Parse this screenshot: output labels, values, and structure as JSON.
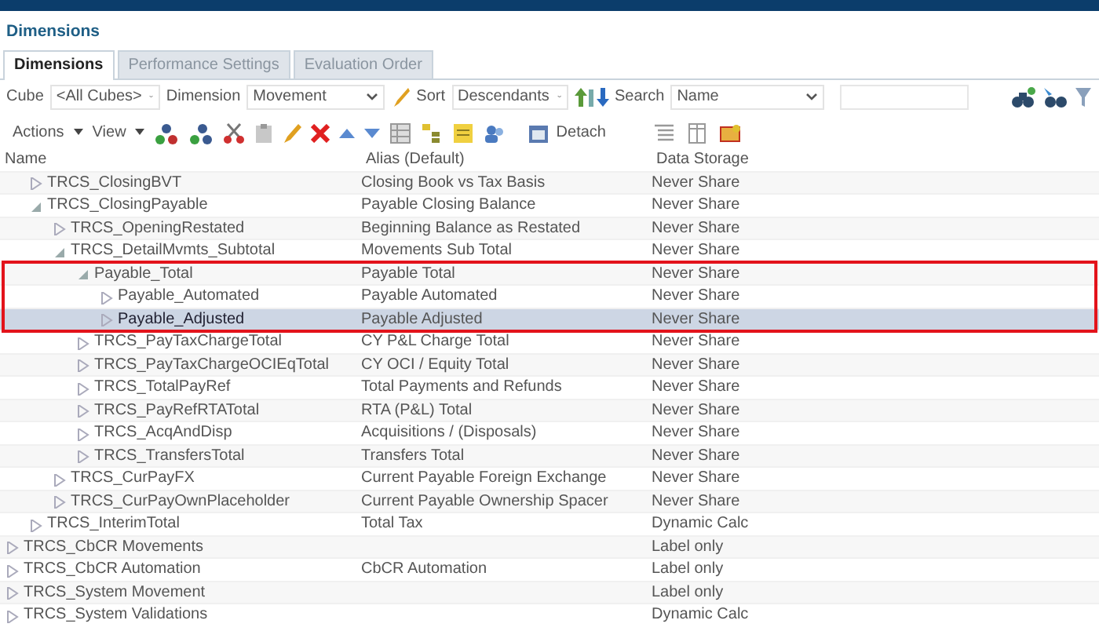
{
  "page_title": "Dimensions",
  "tabs": [
    {
      "label": "Dimensions",
      "selected": true
    },
    {
      "label": "Performance Settings",
      "selected": false
    },
    {
      "label": "Evaluation Order",
      "selected": false
    }
  ],
  "filters": {
    "cube_label": "Cube",
    "cube_value": "<All Cubes>",
    "dimension_label": "Dimension",
    "dimension_value": "Movement",
    "sort_label": "Sort",
    "sort_value": "Descendants",
    "search_label": "Search",
    "search_value": "Name"
  },
  "toolbar": {
    "actions": "Actions",
    "view": "View",
    "detach": "Detach"
  },
  "columns": [
    "Name",
    "Alias (Default)",
    "Data Storage"
  ],
  "tree": {
    "continued_items": [
      {
        "name": "TRCS_ClosingBVT",
        "alias": "Closing Book vs Tax Basis",
        "storage": "Never Share",
        "expanded": false,
        "selected": false
      },
      {
        "name": "TRCS_ClosingPayable",
        "alias": "Payable Closing Balance",
        "storage": "Never Share",
        "expanded": true,
        "selected": false,
        "children": [
          {
            "name": "TRCS_OpeningRestated",
            "alias": "Beginning Balance as Restated",
            "storage": "Never Share",
            "expanded": false,
            "selected": false
          },
          {
            "name": "TRCS_DetailMvmts_Subtotal",
            "alias": "Movements Sub Total",
            "storage": "Never Share",
            "expanded": true,
            "selected": false,
            "children": [
              {
                "name": "Payable_Total",
                "alias": "Payable Total",
                "storage": "Never Share",
                "expanded": true,
                "selected": false,
                "outlined": true,
                "children": [
                  {
                    "name": "Payable_Automated",
                    "alias": "Payable Automated",
                    "storage": "Never Share",
                    "expanded": false,
                    "selected": false,
                    "outlined": true
                  },
                  {
                    "name": "Payable_Adjusted",
                    "alias": "Payable Adjusted",
                    "storage": "Never Share",
                    "expanded": false,
                    "selected": true,
                    "outlined": true
                  }
                ]
              },
              {
                "name": "TRCS_PayTaxChargeTotal",
                "alias": "CY P&L Charge Total",
                "storage": "Never Share",
                "expanded": false,
                "selected": false
              },
              {
                "name": "TRCS_PayTaxChargeOCIEqTotal",
                "alias": "CY OCI / Equity Total",
                "storage": "Never Share",
                "expanded": false,
                "selected": false
              },
              {
                "name": "TRCS_TotalPayRef",
                "alias": "Total Payments and Refunds",
                "storage": "Never Share",
                "expanded": false,
                "selected": false
              },
              {
                "name": "TRCS_PayRefRTATotal",
                "alias": "RTA (P&L) Total",
                "storage": "Never Share",
                "expanded": false,
                "selected": false
              },
              {
                "name": "TRCS_AcqAndDisp",
                "alias": "Acquisitions / (Disposals)",
                "storage": "Never Share",
                "expanded": false,
                "selected": false
              },
              {
                "name": "TRCS_TransfersTotal",
                "alias": "Transfers Total",
                "storage": "Never Share",
                "expanded": false,
                "selected": false
              }
            ]
          },
          {
            "name": "TRCS_CurPayFX",
            "alias": "Current Payable Foreign Exchange",
            "storage": "Never Share",
            "expanded": false,
            "selected": false
          },
          {
            "name": "TRCS_CurPayOwnPlaceholder",
            "alias": "Current Payable Ownership Spacer",
            "storage": "Never Share",
            "expanded": false,
            "selected": false
          }
        ]
      },
      {
        "name": "TRCS_InterimTotal",
        "alias": "Total Tax",
        "storage": "Dynamic Calc",
        "expanded": false,
        "selected": false
      }
    ],
    "root_items": [
      {
        "name": "TRCS_CbCR Movements",
        "storage": "Label only",
        "expanded": false,
        "selected": false
      },
      {
        "name": "TRCS_CbCR Automation",
        "alias": "CbCR Automation",
        "storage": "Label only",
        "expanded": false,
        "selected": false
      },
      {
        "name": "TRCS_System Movement",
        "storage": "Label only",
        "expanded": false,
        "selected": false
      },
      {
        "name": "TRCS_System Validations",
        "storage": "Dynamic Calc",
        "expanded": false,
        "selected": false
      }
    ]
  }
}
